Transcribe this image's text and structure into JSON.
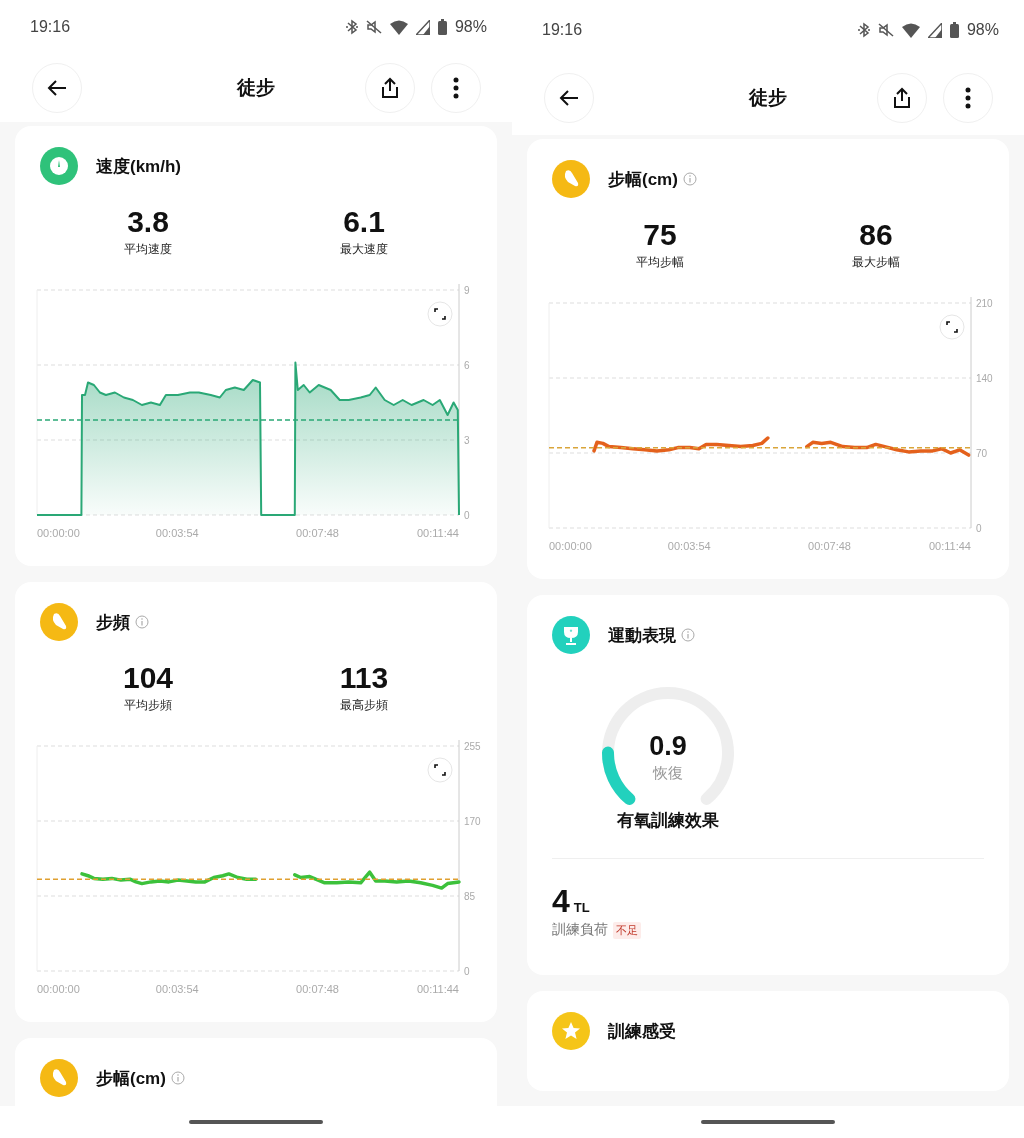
{
  "screens": [
    {
      "status_bar": {
        "time": "19:16",
        "battery": "98%"
      },
      "header": {
        "title": "徒步"
      },
      "cards": [
        {
          "kind": "metric",
          "title": "速度(km/h)",
          "info": false,
          "color": "#2fc27a",
          "stats": [
            {
              "value": "3.8",
              "label": "平均速度"
            },
            {
              "value": "6.1",
              "label": "最大速度"
            }
          ],
          "chart_data": {
            "type": "area",
            "x": [
              0,
              74,
              75,
              80,
              85,
              95,
              105,
              115,
              130,
              145,
              160,
              175,
              190,
              205,
              215,
              235,
              255,
              270,
              290,
              305,
              315,
              330,
              345,
              360,
              372,
              374,
              430,
              431,
              435,
              445,
              455,
              470,
              490,
              505,
              520,
              540,
              555,
              565,
              580,
              595,
              610,
              625,
              645,
              660,
              672,
              685,
              695,
              702,
              704
            ],
            "series": [
              {
                "color": "#2aa876",
                "values": [
                  0,
                  0,
                  4.8,
                  4.8,
                  5.3,
                  5.2,
                  4.9,
                  4.8,
                  4.9,
                  4.7,
                  4.6,
                  4.4,
                  4.5,
                  4.4,
                  4.8,
                  4.8,
                  4.9,
                  4.9,
                  4.8,
                  4.7,
                  5.0,
                  5.1,
                  5.0,
                  5.4,
                  5.3,
                  0,
                  0,
                  6.1,
                  5.0,
                  5.2,
                  4.9,
                  5.2,
                  5.0,
                  4.6,
                  4.6,
                  4.7,
                  4.8,
                  5.1,
                  4.6,
                  4.4,
                  4.6,
                  4.4,
                  4.6,
                  4.4,
                  4.6,
                  4.0,
                  4.5,
                  4.2,
                  0
                ]
              }
            ],
            "xlim": [
              0,
              704
            ],
            "ylim": [
              0,
              9
            ],
            "xticks": [
              {
                "value": 0,
                "label": "00:00:00"
              },
              {
                "value": 234,
                "label": "00:03:54"
              },
              {
                "value": 468,
                "label": "00:07:48"
              },
              {
                "value": 704,
                "label": "00:11:44"
              }
            ],
            "yticks": [
              0,
              3,
              6,
              9
            ],
            "ref_lines": [
              {
                "axis": "y",
                "value": 3.8,
                "color": "#2aa876"
              }
            ]
          }
        },
        {
          "kind": "metric",
          "title": "步頻",
          "info": true,
          "color": "#f5b914",
          "stats": [
            {
              "value": "104",
              "label": "平均步頻"
            },
            {
              "value": "113",
              "label": "最高步頻"
            }
          ],
          "chart_data": {
            "type": "line",
            "x": [
              75,
              85,
              95,
              110,
              125,
              140,
              155,
              165,
              175,
              190,
              205,
              220,
              235,
              250,
              265,
              280,
              295,
              310,
              320,
              335,
              350,
              365,
              400,
              430,
              440,
              455,
              465,
              480,
              500,
              520,
              540,
              550,
              555,
              565,
              580,
              600,
              620,
              640,
              660,
              675,
              685,
              704
            ],
            "series": [
              {
                "color": "#3cc13b",
                "values": [
                  110,
                  108,
                  105,
                  104,
                  105,
                  103,
                  104,
                  101,
                  99,
                  101,
                  102,
                  101,
                  103,
                  102,
                  101,
                  101,
                  106,
                  108,
                  110,
                  106,
                  104,
                  104,
                  null,
                  109,
                  106,
                  107,
                  104,
                  100,
                  100,
                  101,
                  100,
                  108,
                  112,
                  102,
                  102,
                  101,
                  102,
                  100,
                  97,
                  94,
                  99,
                  101
                ]
              }
            ],
            "xlim": [
              0,
              704
            ],
            "ylim": [
              0,
              255
            ],
            "xticks": [
              {
                "value": 0,
                "label": "00:00:00"
              },
              {
                "value": 234,
                "label": "00:03:54"
              },
              {
                "value": 468,
                "label": "00:07:48"
              },
              {
                "value": 704,
                "label": "00:11:44"
              }
            ],
            "yticks": [
              0,
              85,
              170,
              255
            ],
            "ref_lines": [
              {
                "axis": "y",
                "value": 104,
                "color": "#e0a030"
              }
            ]
          }
        },
        {
          "kind": "header",
          "title": "步幅(cm)",
          "info": true,
          "color": "#f5b914"
        }
      ]
    },
    {
      "status_bar": {
        "time": "19:16",
        "battery": "98%"
      },
      "header": {
        "title": "徒步"
      },
      "cards": [
        {
          "kind": "metric",
          "title": "步幅(cm)",
          "info": true,
          "color": "#f5b914",
          "stats": [
            {
              "value": "75",
              "label": "平均步幅"
            },
            {
              "value": "86",
              "label": "最大步幅"
            }
          ],
          "chart_data": {
            "type": "line",
            "x": [
              75,
              80,
              90,
              100,
              120,
              140,
              160,
              180,
              200,
              215,
              235,
              250,
              262,
              280,
              300,
              320,
              340,
              355,
              365,
              400,
              430,
              440,
              455,
              470,
              490,
              510,
              530,
              545,
              560,
              580,
              600,
              620,
              640,
              655,
              670,
              685,
              700
            ],
            "series": [
              {
                "color": "#e4611c",
                "values": [
                  72,
                  80,
                  79,
                  76,
                  75,
                  74,
                  73,
                  72,
                  73,
                  75,
                  75,
                  74,
                  78,
                  78,
                  77,
                  76,
                  77,
                  79,
                  84,
                  null,
                  76,
                  80,
                  79,
                  80,
                  76,
                  75,
                  75,
                  78,
                  76,
                  73,
                  71,
                  72,
                  72,
                  74,
                  70,
                  73,
                  68
                ]
              }
            ],
            "xlim": [
              0,
              704
            ],
            "ylim": [
              0,
              210
            ],
            "xticks": [
              {
                "value": 0,
                "label": "00:00:00"
              },
              {
                "value": 234,
                "label": "00:03:54"
              },
              {
                "value": 468,
                "label": "00:07:48"
              },
              {
                "value": 704,
                "label": "00:11:44"
              }
            ],
            "yticks": [
              0,
              70,
              140,
              210
            ],
            "ref_lines": [
              {
                "axis": "y",
                "value": 75,
                "color": "#d9a53a"
              }
            ]
          }
        },
        {
          "kind": "performance",
          "title": "運動表現",
          "info": true,
          "color": "#22d1bd",
          "gauge": {
            "value": "0.9",
            "status": "恢復",
            "level": 0.18,
            "label": "有氧訓練效果"
          },
          "load": {
            "value": "4",
            "unit": "TL",
            "label": "訓練負荷",
            "tag": "不足"
          }
        },
        {
          "kind": "header",
          "title": "訓練感受",
          "info": false,
          "color": "#f5c518"
        }
      ]
    }
  ]
}
